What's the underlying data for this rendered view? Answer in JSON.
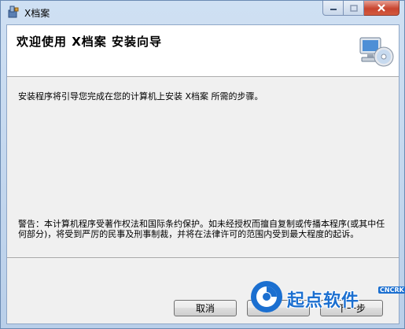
{
  "window": {
    "title": "X档案",
    "buttons": {
      "minimize": "minimize",
      "maximize": "maximize",
      "close": "close"
    }
  },
  "header": {
    "title": "欢迎使用 X档案 安装向导",
    "icon": "computer-cd-icon"
  },
  "body": {
    "intro": "安装程序将引导您完成在您的计算机上安装 X档案 所需的步骤。",
    "warning": "警告：本计算机程序受著作权法和国际条约保护。如未经授权而擅自复制或传播本程序(或其中任何部分)，将受到严厉的民事及刑事制裁，并将在法律许可的范围内受到最大程度的起诉。"
  },
  "footer": {
    "cancel_label": "取消",
    "prev_label": "",
    "next_label": "下一步"
  },
  "watermark": {
    "text": "起点软件",
    "tag": "CNCRK"
  },
  "colors": {
    "title_bar": "#b9cfe9",
    "client_bg": "#f0f0f0",
    "header_bg": "#ffffff",
    "close_red": "#c8452f",
    "watermark_blue": "#1b6fd0"
  }
}
